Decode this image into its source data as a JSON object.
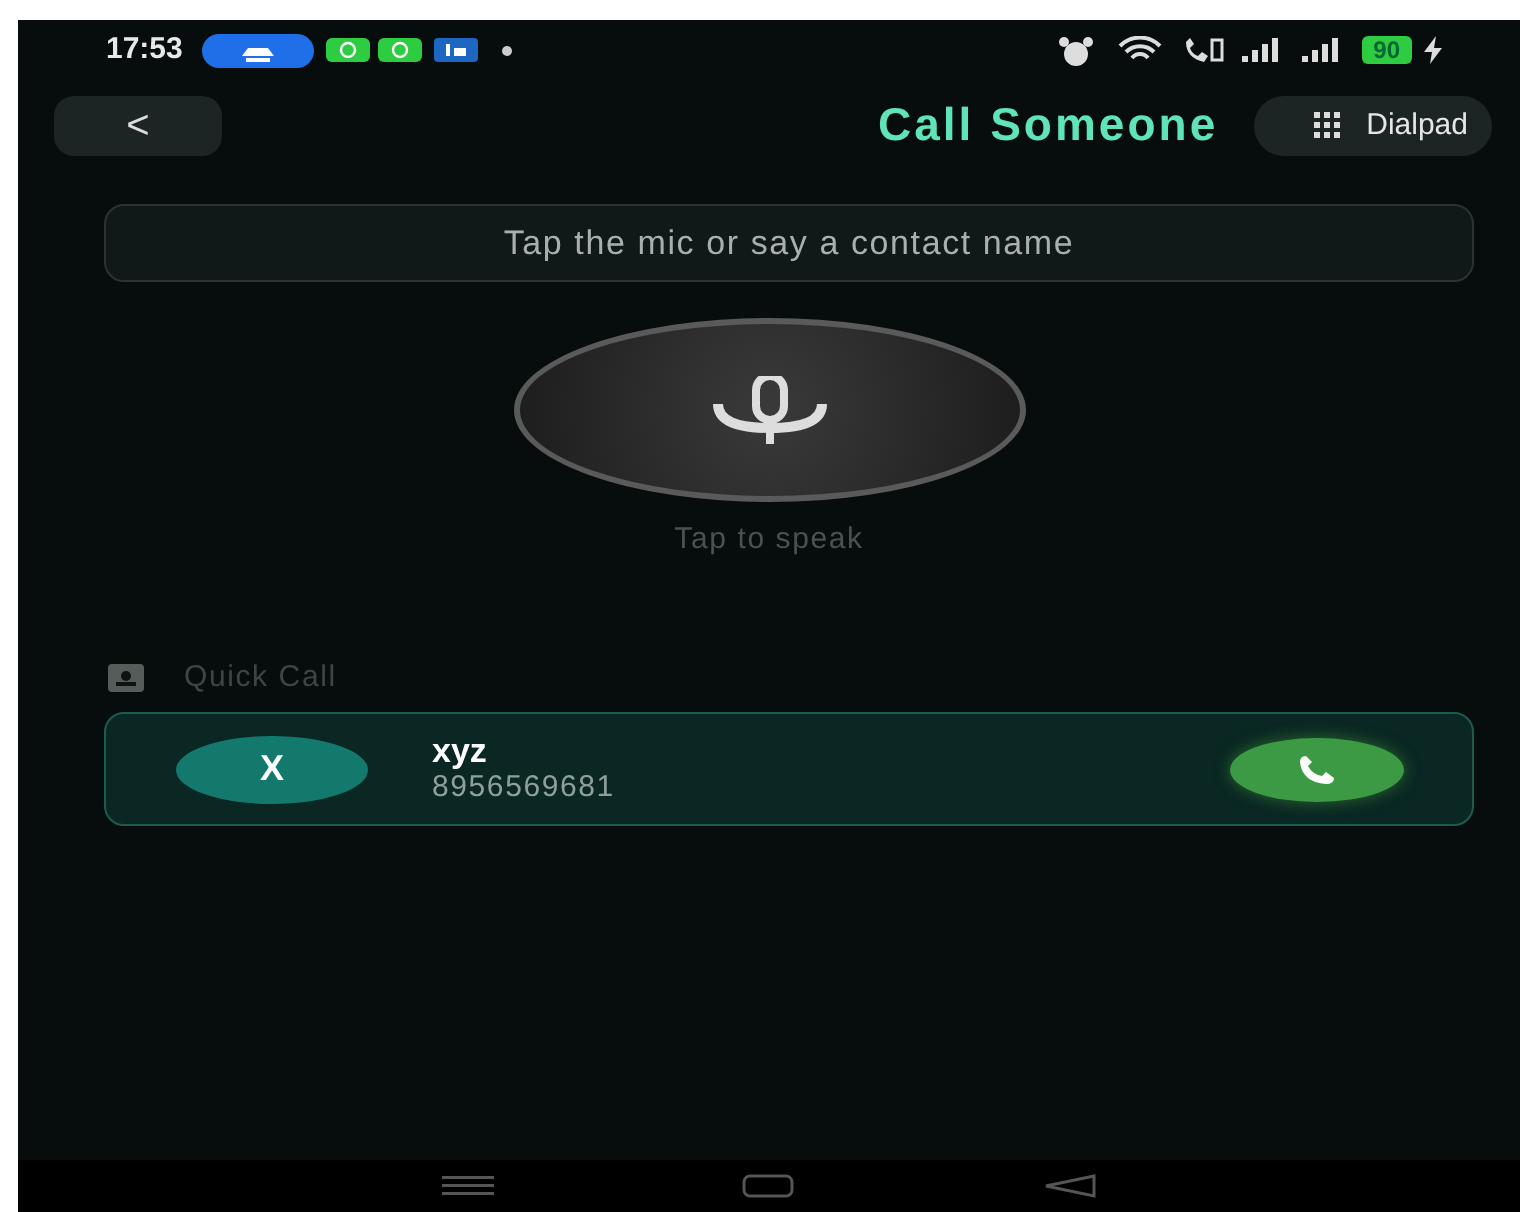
{
  "status_bar": {
    "time": "17:53",
    "battery": "90"
  },
  "header": {
    "back": "<",
    "title": "Call Someone",
    "dialpad_button": "Dialpad"
  },
  "prompt": {
    "text": "Tap the mic or say a contact name"
  },
  "mic": {
    "label": "Tap to speak"
  },
  "quick_call": {
    "heading": "Quick Call",
    "contacts": [
      {
        "initial": "X",
        "name": "xyz",
        "number": "8956569681"
      }
    ]
  }
}
